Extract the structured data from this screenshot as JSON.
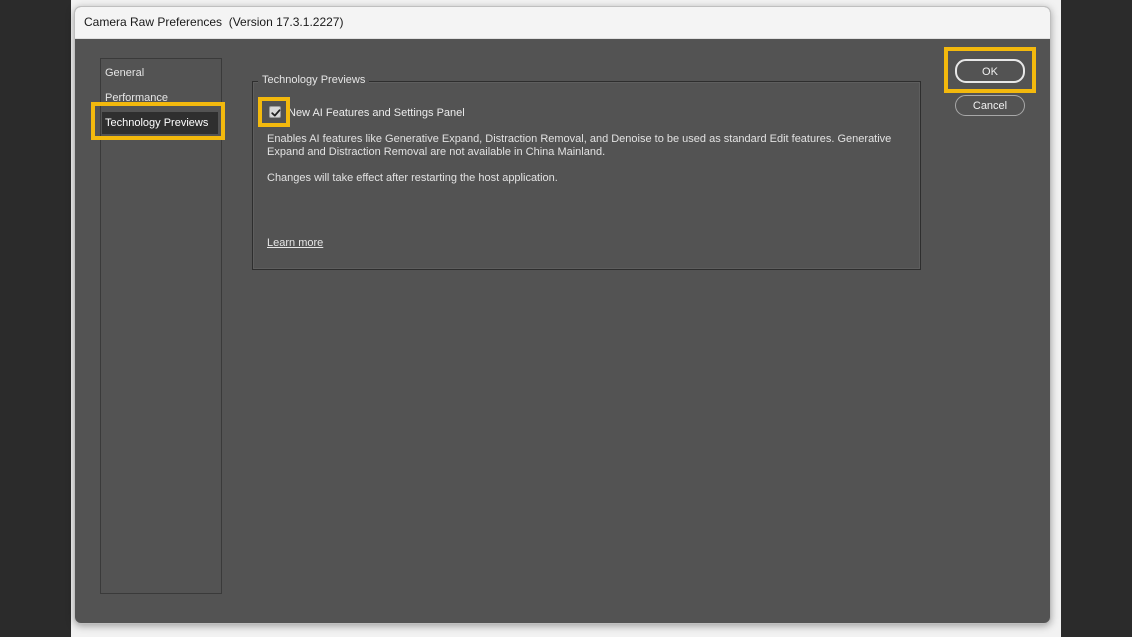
{
  "window": {
    "title": "Camera Raw Preferences  (Version 17.3.1.2227)"
  },
  "nav": {
    "items": [
      {
        "label": "General"
      },
      {
        "label": "Performance"
      },
      {
        "label": "Technology Previews",
        "selected": true
      }
    ]
  },
  "group": {
    "legend": "Technology Previews",
    "checkbox": {
      "label": "New AI Features and Settings Panel",
      "checked": true
    },
    "description": "Enables AI features like Generative Expand, Distraction Removal, and Denoise to be used as standard Edit features. Generative Expand and Distraction Removal are not available in China Mainland.",
    "restart_note": "Changes will take effect after restarting the host application.",
    "learn_more": "Learn more"
  },
  "buttons": {
    "ok": "OK",
    "cancel": "Cancel"
  },
  "colors": {
    "highlight": "#f3b90d",
    "panel_bg": "#535353",
    "selected_bg": "#2f2f2f"
  },
  "icons": {
    "checkbox": "checkmark-icon"
  }
}
